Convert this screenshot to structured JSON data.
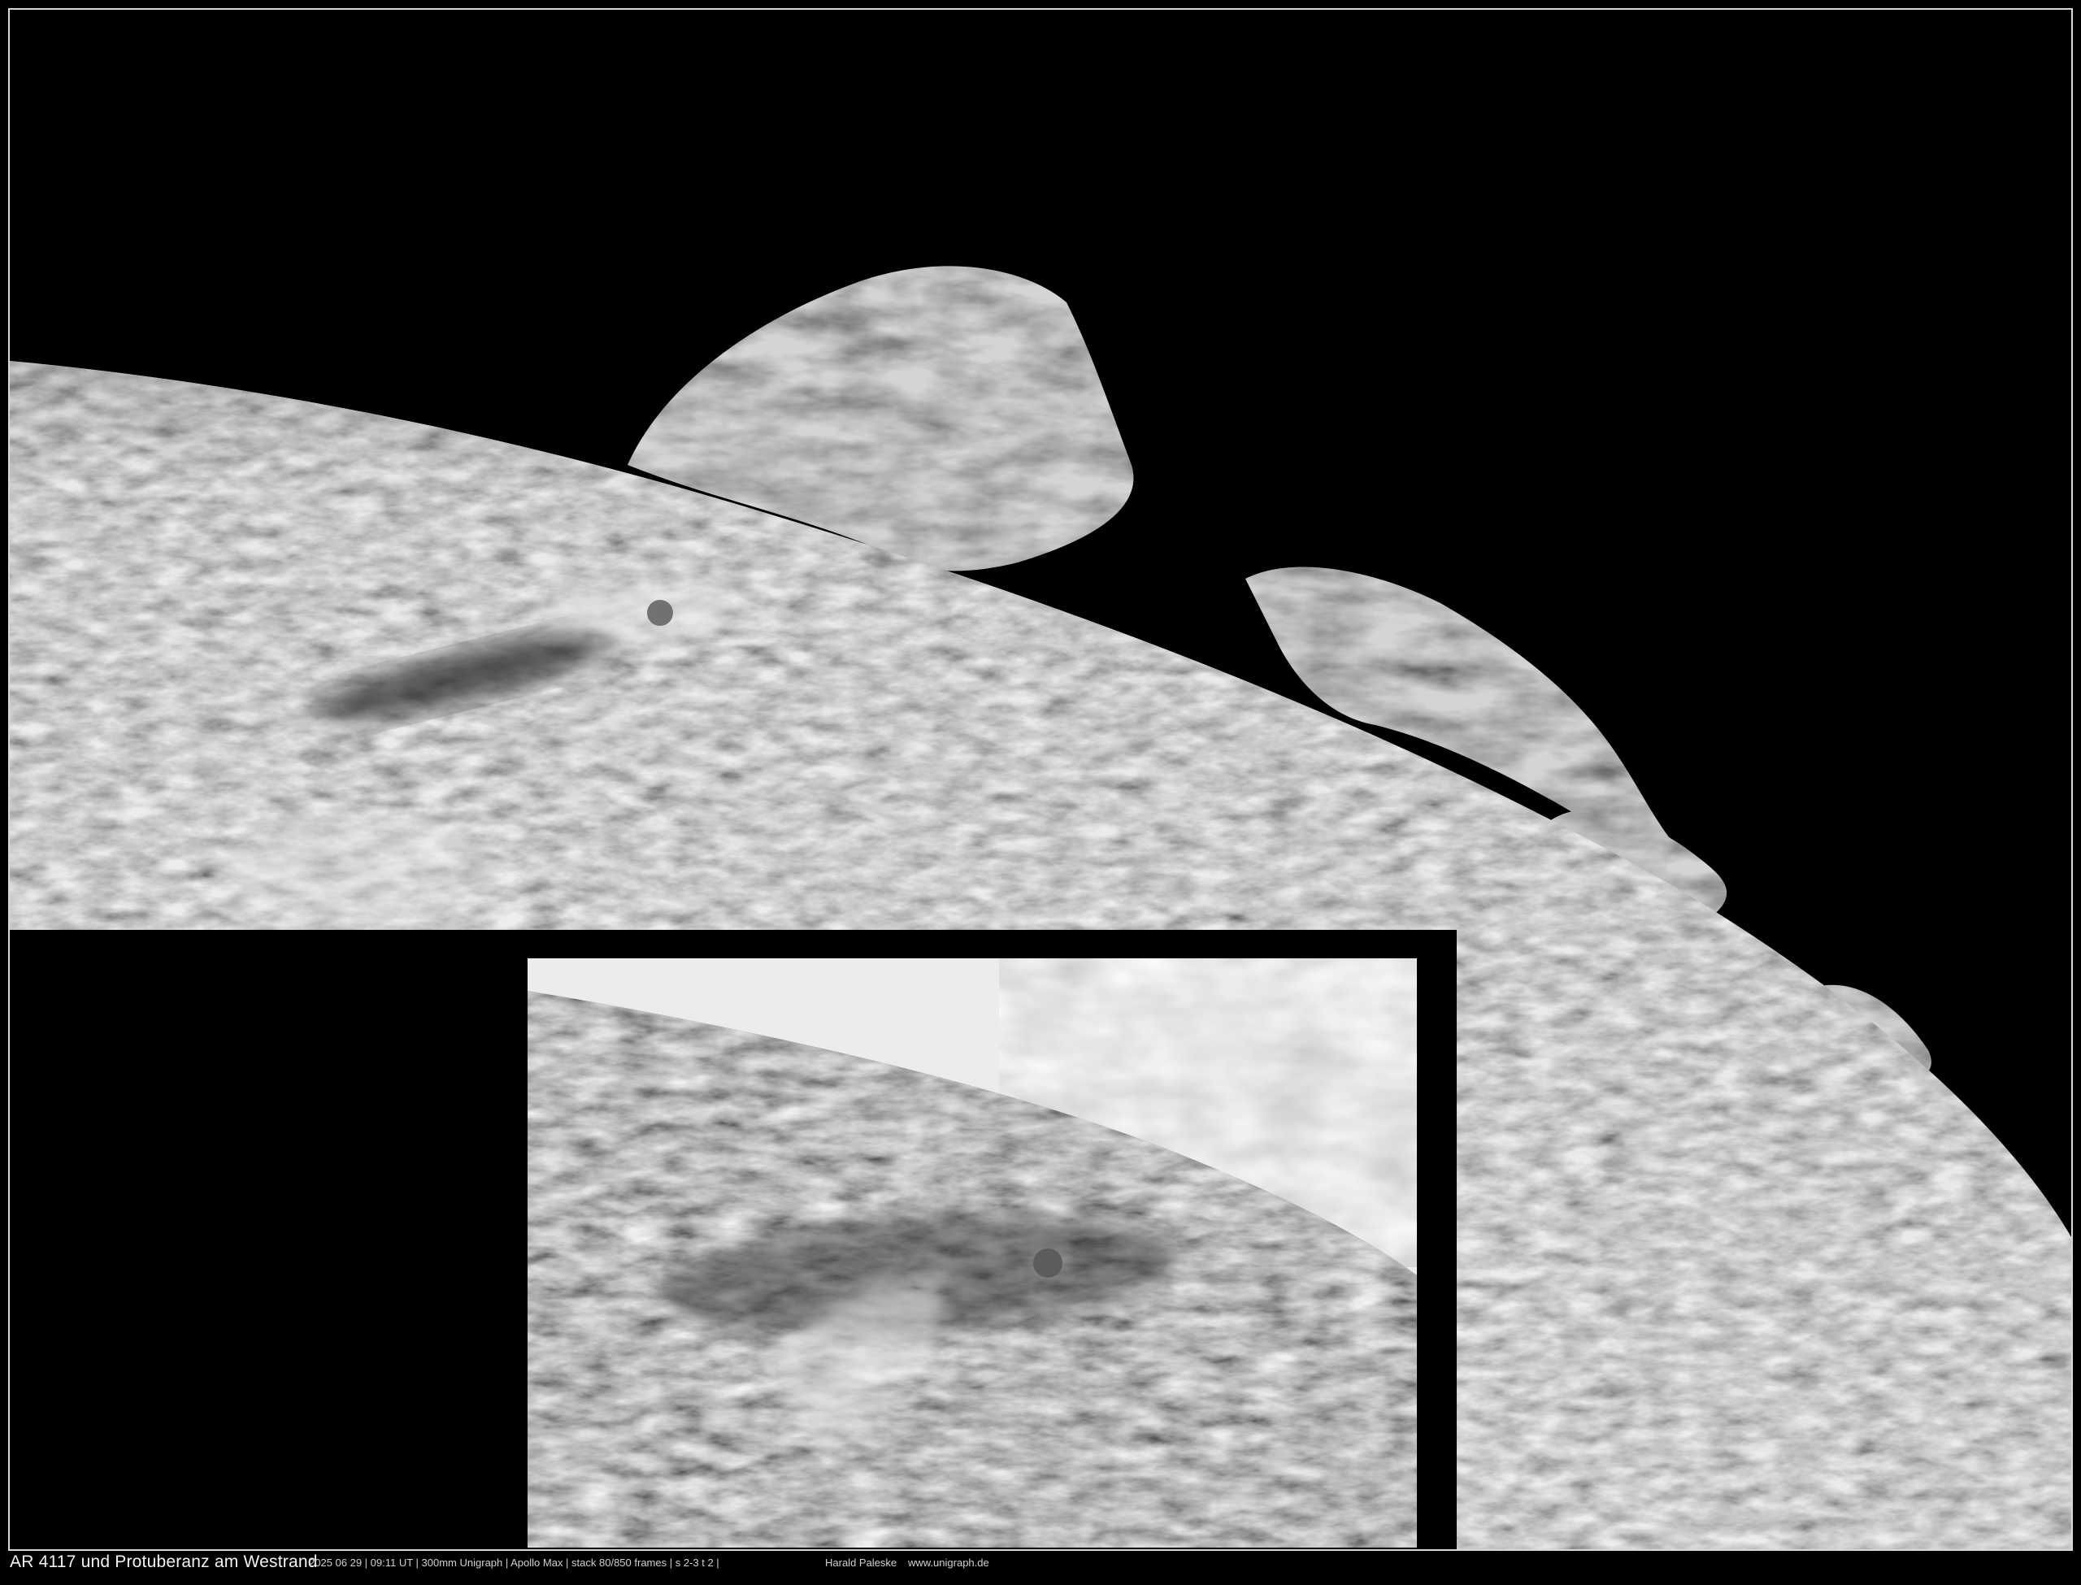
{
  "caption": {
    "title": "AR 4117 und Protuberanz am Westrand",
    "details": "2025 06 29 | 09:11 UT | 300mm Unigraph | Apollo Max | stack 80/850 frames | s 2-3 t 2 |",
    "author": "Harald Paleske",
    "url": "www.unigraph.de"
  },
  "colors": {
    "background": "#000000",
    "frame_border": "#d8d8d8",
    "caption_text": "#e8e8e8"
  }
}
